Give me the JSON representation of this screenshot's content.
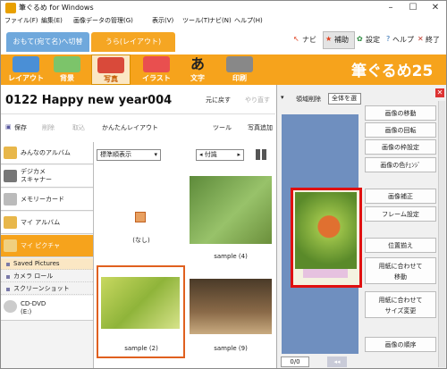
{
  "window": {
    "title": "筆ぐるめ for Windows",
    "min": "–",
    "max": "☐",
    "close": "✕"
  },
  "menu": [
    "ファイル(F)",
    "編集(E)",
    "画像データの管理(G)",
    "表示(V)",
    "ツール(T)",
    "ナビ(N)",
    "ヘルプ(H)"
  ],
  "tabs": {
    "front": "おもて(宛て名)へ切替",
    "back": "うら(レイアウト)"
  },
  "toplinks": {
    "navi": "ナビ",
    "hojo": "補助",
    "settings": "設定",
    "help": "ヘルプ",
    "exit": "終了"
  },
  "toolbar": {
    "items": [
      "レイアウト",
      "背景",
      "写真",
      "イラスト",
      "文字",
      "印刷"
    ],
    "brand": "筆ぐるめ25"
  },
  "doc": {
    "title": "0122  Happy new year004",
    "undo": "元に戻す",
    "redo": "やり直す"
  },
  "actions": {
    "save": "保存",
    "delete": "削除",
    "import": "取込",
    "easy_layout": "かんたんレイアウト",
    "tool": "ツール",
    "add_photo": "写真追加"
  },
  "sidebar": {
    "items": [
      "みんなのアルバム",
      "デジカメ\nスキャナー",
      "メモリーカード",
      "マイ アルバム",
      "マイ ピクチャ"
    ],
    "subs": [
      "Saved Pictures",
      "カメラ ロール",
      "スクリーンショット"
    ],
    "cddvd": "CD-DVD\n(E:)"
  },
  "grid": {
    "sort": "標準順表示",
    "date": "付識",
    "captions": [
      "(なし)",
      "sample (4)",
      "sample (2)",
      "sample (9)"
    ]
  },
  "preview": {
    "area_delete": "領域削除",
    "select_all": "全体を選",
    "page": "0/0"
  },
  "ops": [
    "画像の移動",
    "画像の回転",
    "画像の枠設定",
    "画像の色ﾁｪﾝｼﾞ",
    "画像補正",
    "フレーム設定",
    "位置揃え",
    "用紙に合わせて\n移動",
    "用紙に合わせて\nサイズ変更",
    "画像の順序"
  ],
  "colors": {
    "orange": "#f6a31c",
    "selected": "#e0401f",
    "blue": "#6fa8dc"
  }
}
